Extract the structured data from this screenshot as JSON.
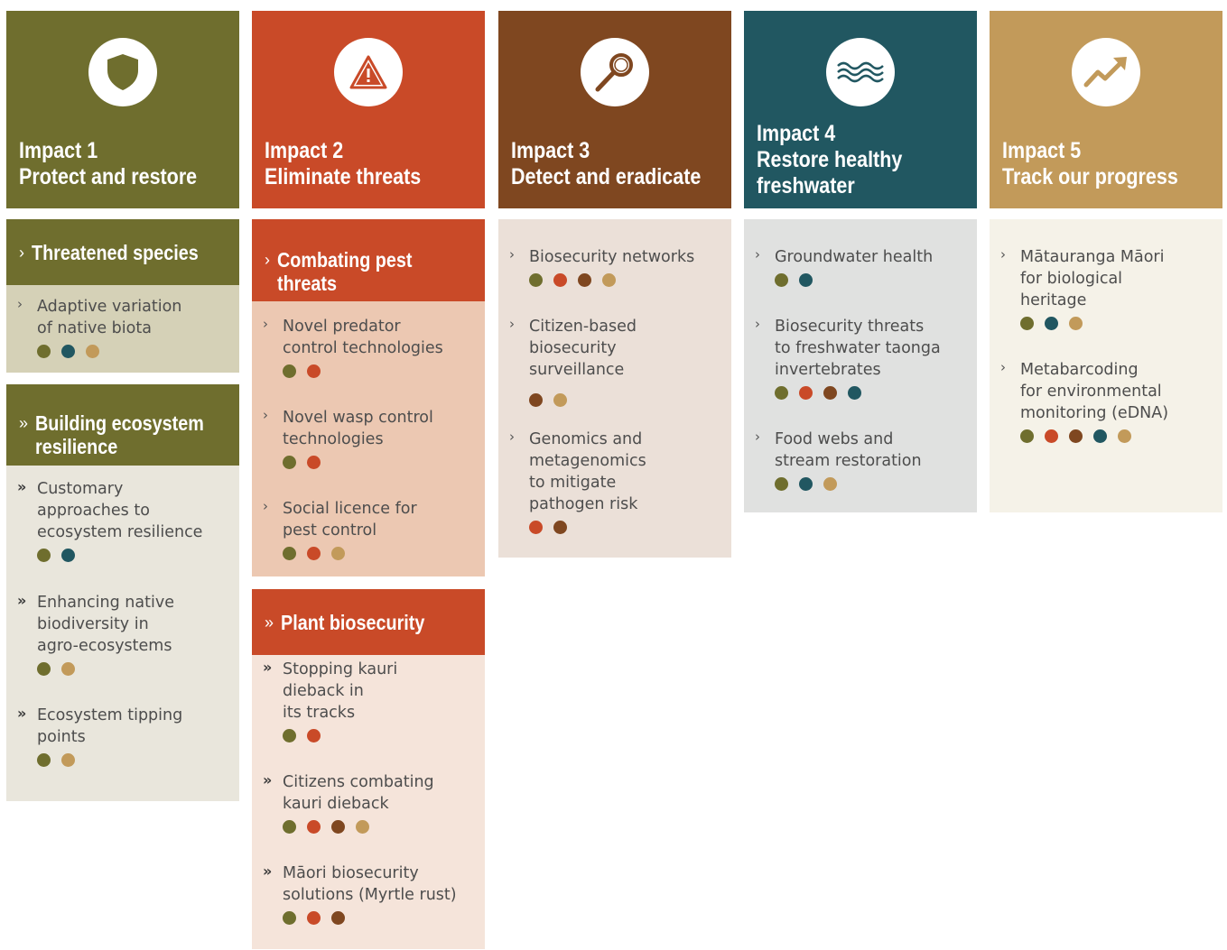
{
  "colors": {
    "olive": "#6f6e2e",
    "red": "#c94a28",
    "brown": "#7f4720",
    "teal": "#215761",
    "gold": "#c29a5a"
  },
  "impacts": [
    {
      "line1": "Impact 1",
      "line2": "Protect and restore"
    },
    {
      "line1": "Impact 2",
      "line2": "Eliminate threats"
    },
    {
      "line1": "Impact 3",
      "line2": "Detect and eradicate"
    },
    {
      "line1": "Impact 4",
      "line2": "Restore healthy",
      "line3": "freshwater"
    },
    {
      "line1": "Impact 5",
      "line2": "Track our progress"
    }
  ],
  "icons": [
    "shield-icon",
    "warning-icon",
    "magnifier-icon",
    "water-waves-icon",
    "trend-up-icon"
  ],
  "col1": {
    "sec1": {
      "title": "Threatened species",
      "items": [
        {
          "label": "Adaptive variation\nof native biota",
          "dots": [
            "olive",
            "teal",
            "gold"
          ]
        }
      ]
    },
    "sec2": {
      "title_l1": "Building ecosystem",
      "title_l2": "resilience",
      "items": [
        {
          "label": "Customary\napproaches to\necosystem resilience",
          "dots": [
            "olive",
            "teal"
          ]
        },
        {
          "label": "Enhancing native\nbiodiversity in\nagro-ecosystems",
          "dots": [
            "olive",
            "gold"
          ]
        },
        {
          "label": "Ecosystem tipping\npoints",
          "dots": [
            "olive",
            "gold"
          ]
        }
      ]
    }
  },
  "col2": {
    "sec1": {
      "title_l1": "Combating pest",
      "title_l2": "threats",
      "items": [
        {
          "label": "Novel predator\ncontrol technologies",
          "dots": [
            "olive",
            "red"
          ]
        },
        {
          "label": "Novel wasp control\ntechnologies",
          "dots": [
            "olive",
            "red"
          ]
        },
        {
          "label": "Social licence for\npest control",
          "dots": [
            "olive",
            "red",
            "gold"
          ]
        }
      ]
    },
    "sec2": {
      "title": "Plant biosecurity",
      "items": [
        {
          "label": "Stopping kauri\ndieback in\nits tracks",
          "dots": [
            "olive",
            "red"
          ]
        },
        {
          "label": "Citizens combating\nkauri dieback",
          "dots": [
            "olive",
            "red",
            "brown",
            "gold"
          ]
        },
        {
          "label": "Māori biosecurity\nsolutions (Myrtle rust)",
          "dots": [
            "olive",
            "red",
            "brown"
          ]
        }
      ]
    }
  },
  "col3": {
    "items": [
      {
        "label": "Biosecurity networks",
        "dots": [
          "olive",
          "red",
          "brown",
          "gold"
        ]
      },
      {
        "label": "Citizen-based\nbiosecurity\nsurveillance",
        "dots": [
          "brown",
          "gold"
        ]
      },
      {
        "label": "Genomics and\nmetagenomics\nto mitigate\npathogen risk",
        "dots": [
          "red",
          "brown"
        ]
      }
    ]
  },
  "col4": {
    "items": [
      {
        "label": "Groundwater health",
        "dots": [
          "olive",
          "teal"
        ]
      },
      {
        "label": "Biosecurity threats\nto freshwater taonga\ninvertebrates",
        "dots": [
          "olive",
          "red",
          "brown",
          "teal"
        ]
      },
      {
        "label": "Food webs and\nstream restoration",
        "dots": [
          "olive",
          "teal",
          "gold"
        ]
      }
    ]
  },
  "col5": {
    "items": [
      {
        "label": "Mātauranga Māori\nfor biological\nheritage",
        "dots": [
          "olive",
          "teal",
          "gold"
        ]
      },
      {
        "label": "Metabarcoding\nfor environmental\nmonitoring (eDNA)",
        "dots": [
          "olive",
          "red",
          "brown",
          "teal",
          "gold"
        ]
      }
    ]
  },
  "bullets": {
    "single": "›",
    "double": "»"
  }
}
